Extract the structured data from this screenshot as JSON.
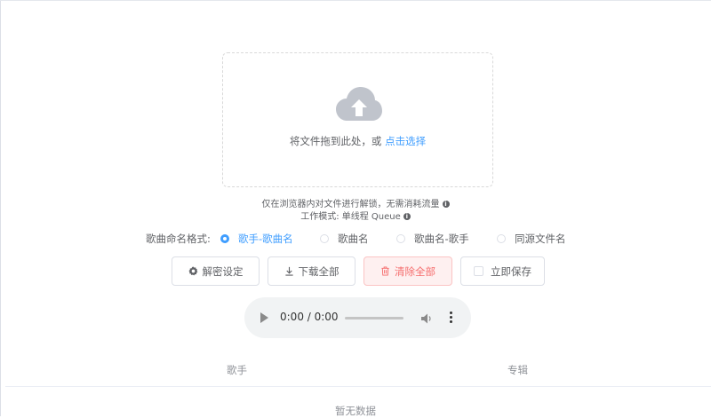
{
  "upload": {
    "hint_prefix": "将文件拖到此处，或",
    "hint_link": "点击选择",
    "icon": "upload-cloud-icon"
  },
  "notes": {
    "line1": "仅在浏览器内对文件进行解锁，无需消耗流量",
    "line2": "工作模式: 单线程 Queue"
  },
  "naming": {
    "label": "歌曲命名格式:",
    "options": [
      "歌手-歌曲名",
      "歌曲名",
      "歌曲名-歌手",
      "同源文件名"
    ],
    "selected": "歌手-歌曲名"
  },
  "buttons": {
    "settings": "解密设定",
    "download_all": "下载全部",
    "clear_all": "清除全部",
    "save_now": "立即保存"
  },
  "player": {
    "time": "0:00 / 0:00"
  },
  "table": {
    "columns": [
      "歌手",
      "专辑"
    ],
    "empty_text": "暂无数据"
  },
  "colors": {
    "accent": "#409eff",
    "danger": "#f56c6c",
    "danger_bg": "#fef0f0"
  }
}
